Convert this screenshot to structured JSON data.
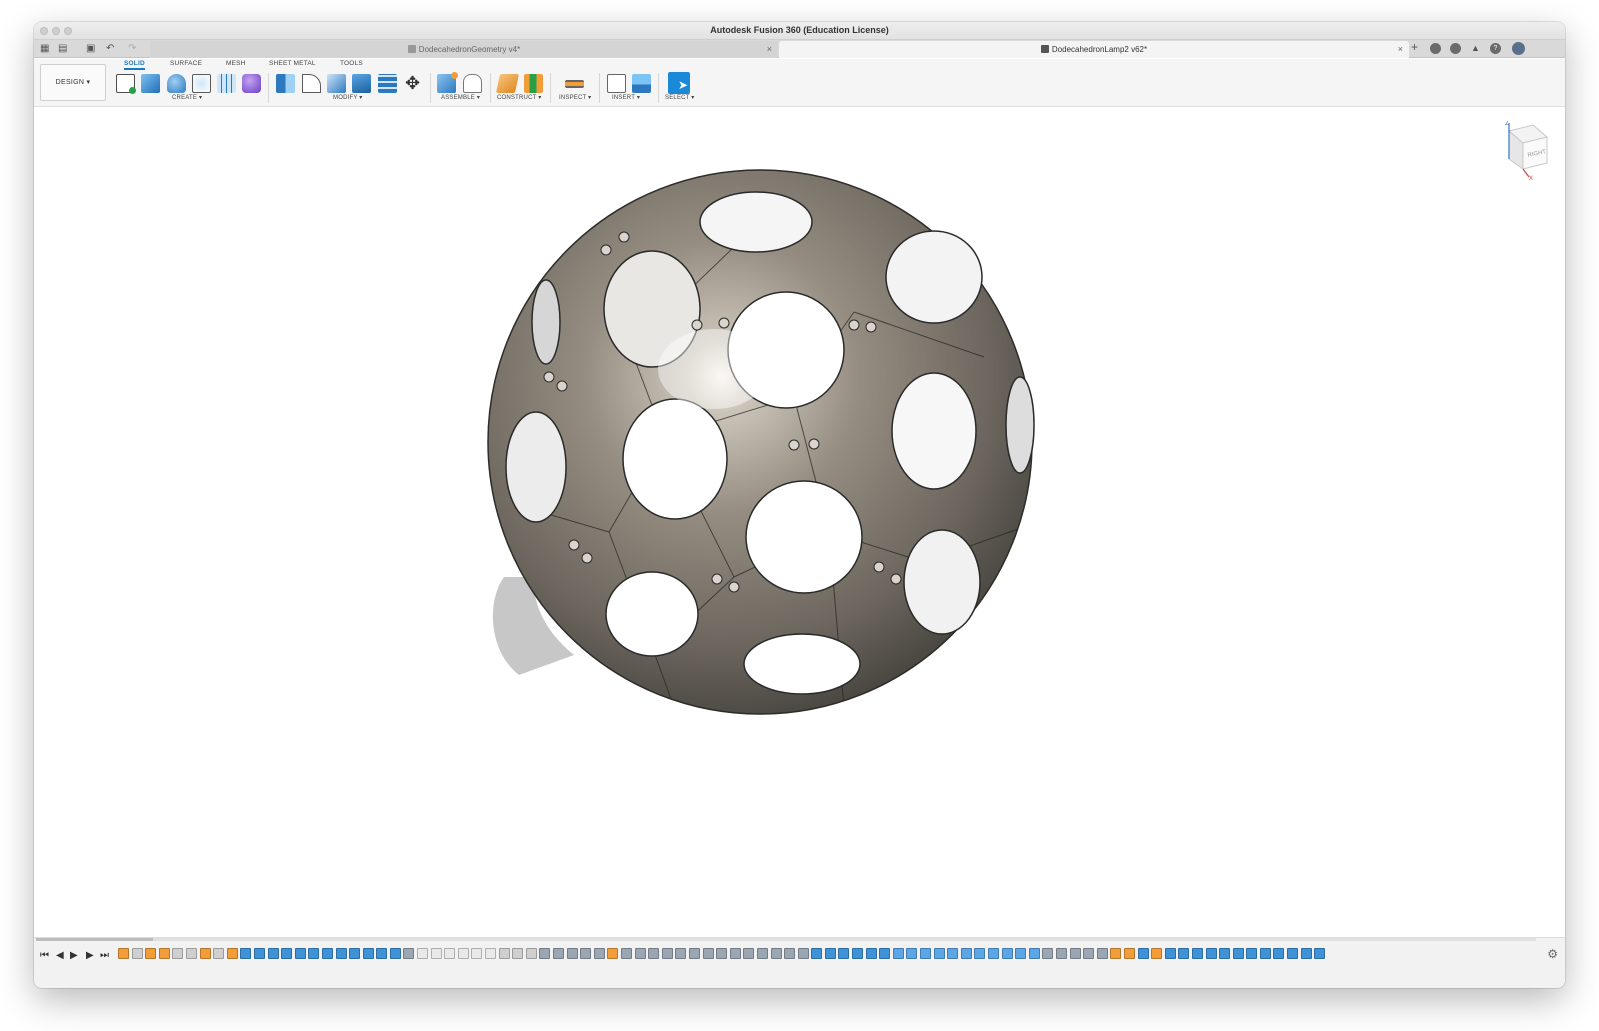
{
  "window": {
    "title": "Autodesk Fusion 360 (Education License)"
  },
  "tabs": [
    {
      "label": "DodecahedronGeometry v4*",
      "active": false
    },
    {
      "label": "DodecahedronLamp2 v62*",
      "active": true
    }
  ],
  "icons": {
    "tab_close": "×",
    "new_tab": "+",
    "undo": "↶",
    "redo": "↷",
    "apps": "▦",
    "file": "▤",
    "save": "▣",
    "gear": "⚙",
    "help": "?",
    "notify": "🔔",
    "user": "●"
  },
  "toolbar": {
    "workspace_label": "DESIGN ▾",
    "tabs": [
      "SOLID",
      "SURFACE",
      "MESH",
      "SHEET METAL",
      "TOOLS"
    ],
    "active_tab": "SOLID",
    "groups": [
      {
        "label": "CREATE ▾"
      },
      {
        "label": "MODIFY ▾"
      },
      {
        "label": "ASSEMBLE ▾"
      },
      {
        "label": "CONSTRUCT ▾"
      },
      {
        "label": "INSPECT ▾"
      },
      {
        "label": "INSERT ▾"
      },
      {
        "label": "SELECT ▾"
      }
    ]
  },
  "viewcube": {
    "face_label": "RIGHT",
    "axis_z": "Z",
    "axis_x": "X"
  },
  "playback": {
    "first": "⏮",
    "prev": "◀",
    "play": "▶",
    "next": "▶",
    "last": "⏭"
  },
  "colors": {
    "accent": "#1a78c2",
    "model_body": "#8a8378",
    "sketch_orange": "#f29d38",
    "feature_blue": "#3d92d8"
  }
}
